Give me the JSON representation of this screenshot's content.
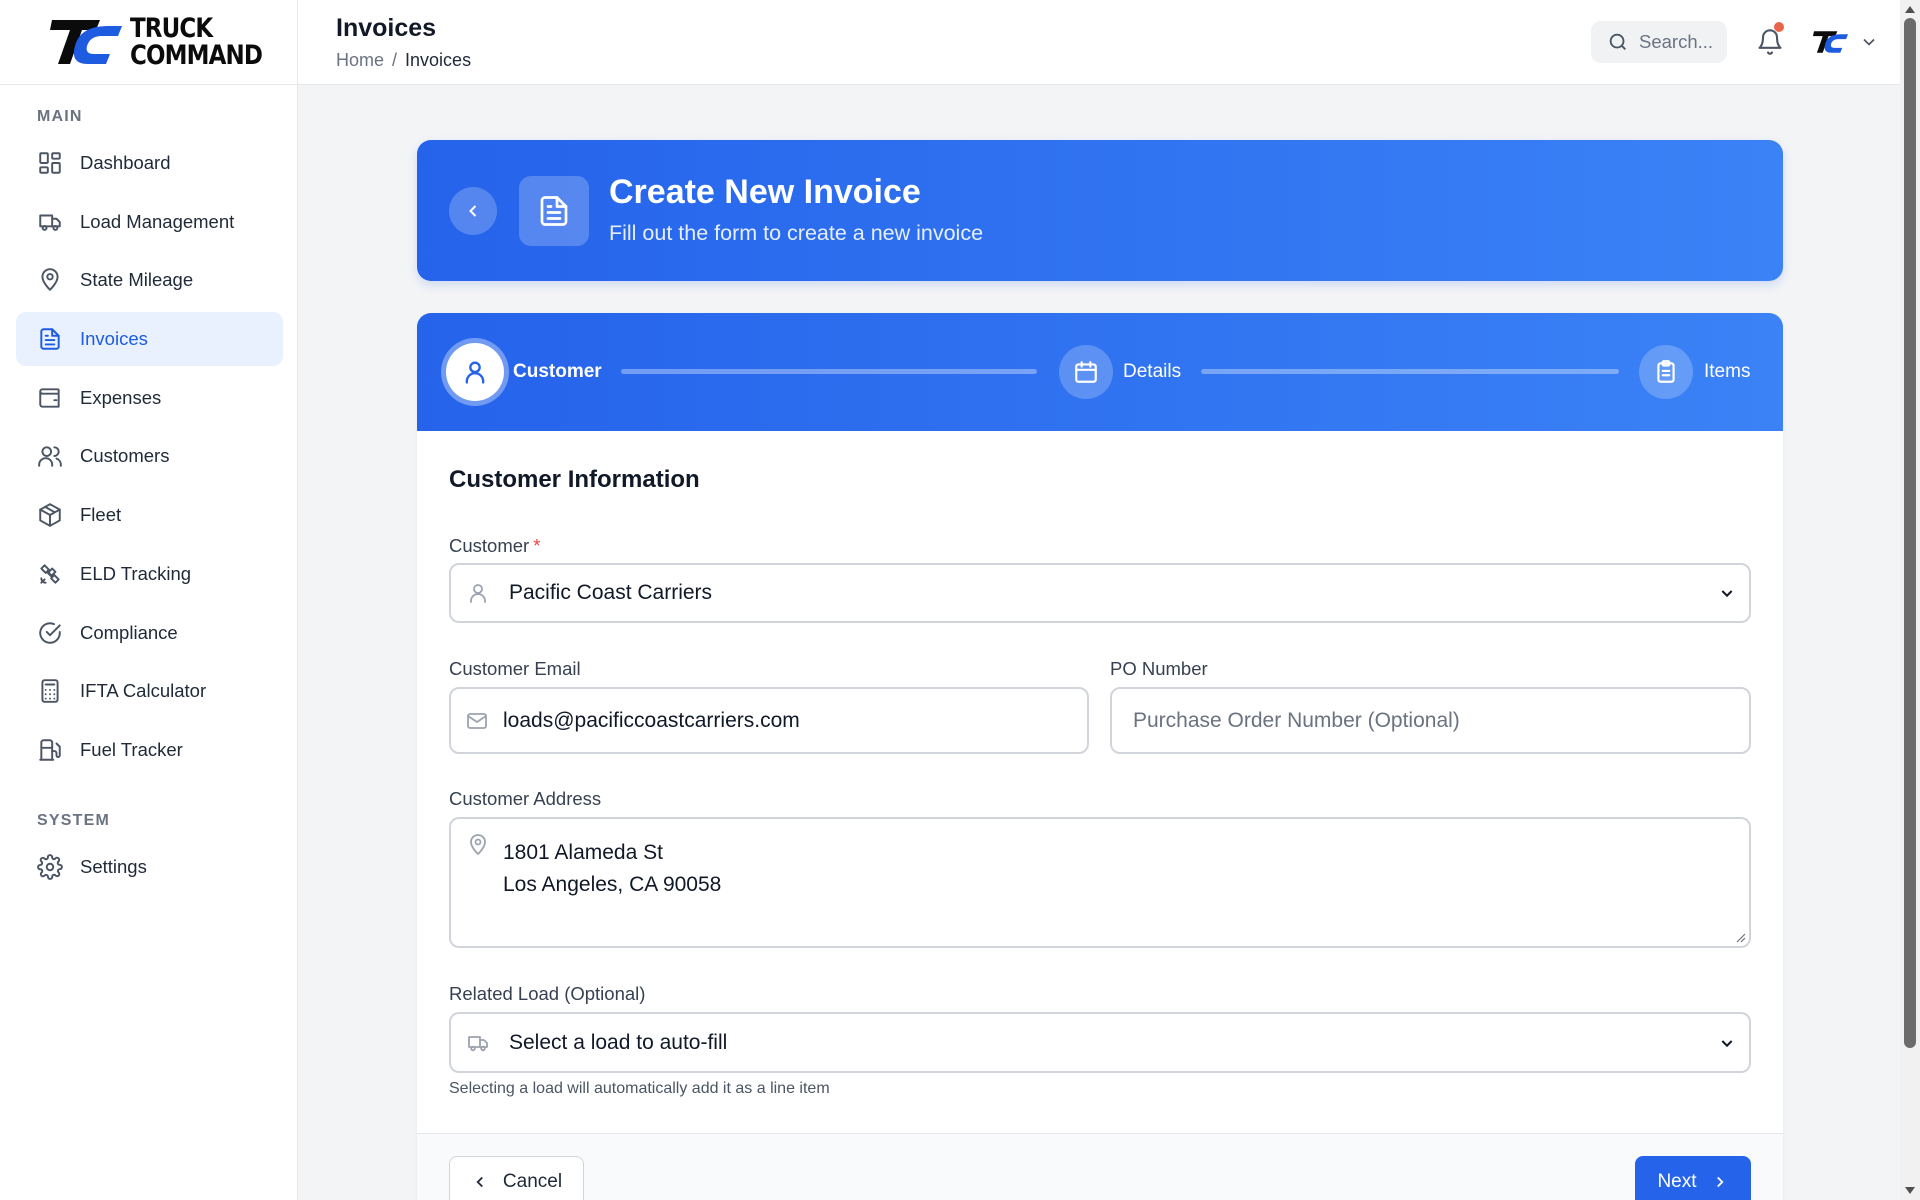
{
  "brand": {
    "line1": "TRUCK",
    "line2": "COMMAND",
    "accent_color": "#1d5be0"
  },
  "sidebar": {
    "main_label": "MAIN",
    "items": [
      {
        "label": "Dashboard",
        "icon": "dashboard-icon"
      },
      {
        "label": "Load Management",
        "icon": "truck-icon"
      },
      {
        "label": "State Mileage",
        "icon": "map-pin-icon"
      },
      {
        "label": "Invoices",
        "icon": "file-text-icon",
        "active": true
      },
      {
        "label": "Expenses",
        "icon": "wallet-icon"
      },
      {
        "label": "Customers",
        "icon": "users-icon"
      },
      {
        "label": "Fleet",
        "icon": "package-icon"
      },
      {
        "label": "ELD Tracking",
        "icon": "satellite-icon"
      },
      {
        "label": "Compliance",
        "icon": "check-circle-icon"
      },
      {
        "label": "IFTA Calculator",
        "icon": "calculator-icon"
      },
      {
        "label": "Fuel Tracker",
        "icon": "fuel-icon"
      }
    ],
    "system_label": "SYSTEM",
    "system_items": [
      {
        "label": "Settings",
        "icon": "gear-icon"
      }
    ]
  },
  "header": {
    "title": "Invoices",
    "breadcrumb": {
      "home": "Home",
      "separator": "/",
      "current": "Invoices"
    },
    "search_placeholder": "Search...",
    "has_notification": true
  },
  "hero": {
    "title": "Create New Invoice",
    "subtitle": "Fill out the form to create a new invoice"
  },
  "steps": [
    {
      "label": "Customer",
      "icon": "user-icon",
      "active": true
    },
    {
      "label": "Details",
      "icon": "calendar-icon",
      "active": false
    },
    {
      "label": "Items",
      "icon": "clipboard-icon",
      "active": false
    }
  ],
  "form": {
    "section_title": "Customer Information",
    "customer": {
      "label": "Customer",
      "required_mark": "*",
      "value": "Pacific Coast Carriers"
    },
    "email": {
      "label": "Customer Email",
      "value": "loads@pacificcoastcarriers.com"
    },
    "po_number": {
      "label": "PO Number",
      "placeholder": "Purchase Order Number (Optional)",
      "value": ""
    },
    "address": {
      "label": "Customer Address",
      "line1": "1801 Alameda St",
      "line2": "Los Angeles, CA 90058"
    },
    "related_load": {
      "label": "Related Load (Optional)",
      "value": "Select a load to auto-fill",
      "help": "Selecting a load will automatically add it as a line item"
    }
  },
  "footer": {
    "cancel_label": "Cancel",
    "next_label": "Next"
  }
}
